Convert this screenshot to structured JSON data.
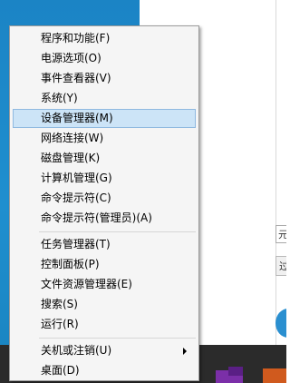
{
  "app_window": {
    "field_text": "元",
    "button_label": "过"
  },
  "context_menu": {
    "items": [
      {
        "label": "程序和功能(F)"
      },
      {
        "label": "电源选项(O)"
      },
      {
        "label": "事件查看器(V)"
      },
      {
        "label": "系统(Y)"
      },
      {
        "label": "设备管理器(M)",
        "highlighted": true
      },
      {
        "label": "网络连接(W)"
      },
      {
        "label": "磁盘管理(K)"
      },
      {
        "label": "计算机管理(G)"
      },
      {
        "label": "命令提示符(C)"
      },
      {
        "label": "命令提示符(管理员)(A)"
      },
      {
        "label": "任务管理器(T)"
      },
      {
        "label": "控制面板(P)"
      },
      {
        "label": "文件资源管理器(E)"
      },
      {
        "label": "搜索(S)"
      },
      {
        "label": "运行(R)"
      },
      {
        "label": "关机或注销(U)",
        "has_submenu": true
      },
      {
        "label": "桌面(D)"
      }
    ],
    "highlight_color": "#cce4f7"
  },
  "taskbar": {
    "icons": [
      "small-blue-icon",
      "onenote-icon",
      "orange-app-icon"
    ]
  }
}
